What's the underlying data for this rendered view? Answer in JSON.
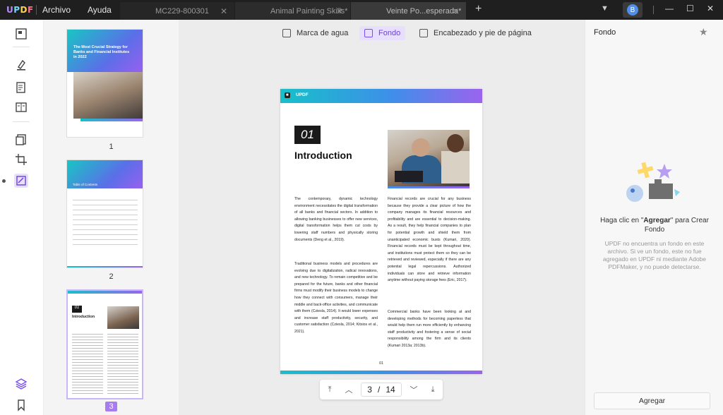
{
  "app": {
    "logo": "UPDF",
    "menu": [
      "Archivo",
      "Ayuda"
    ],
    "tabs": [
      {
        "label": "MC229-800301",
        "active": false
      },
      {
        "label": "Animal Painting Skills*",
        "active": false
      },
      {
        "label": "Veinte Po...esperada*",
        "active": true
      }
    ],
    "user_initial": "B"
  },
  "toolbar": {
    "items": [
      {
        "label": "Marca de agua",
        "icon": "watermark-icon"
      },
      {
        "label": "Fondo",
        "icon": "background-icon",
        "active": true
      },
      {
        "label": "Encabezado y pie de página",
        "icon": "header-footer-icon"
      }
    ]
  },
  "thumbnails": {
    "pages": [
      {
        "number": "1",
        "title": "The Most Crucial Strategy for Banks and Financial Institutes in 2022"
      },
      {
        "number": "2",
        "title": "Table of Contents"
      },
      {
        "number": "3",
        "title": "Introduction",
        "selected": true
      }
    ]
  },
  "page": {
    "brand": "UPDF",
    "chapter_number": "01",
    "heading": "Introduction",
    "left_column": [
      "The contemporary, dynamic technology environment necessitates the digital transformation of all banks and financial sectors. In addition to allowing banking businesses to offer new services, digital transformation helps them cut costs by lowering staff numbers and physically storing documents (Deng et al., 2019).",
      "Traditional business models and procedures are evolving due to digitalization, radical innovations, and new technology. To remain competitive and be prepared for the future, banks and other financial firms must modify their business models to change how they connect with consumers, manage their middle and back-office activities, and communicate with them (Cziesla, 2014). It would lower expenses and increase staff productivity, security, and customer satisfaction (Cziesla, 2014; Kitsios et al., 2021)."
    ],
    "right_column": [
      "Financial records are crucial for any business because they provide a clear picture of how the company manages its financial resources and profitability and are essential to decision-making. As a result, they help financial companies to plan for potential growth and shield them from unanticipated economic busts (Kumari, 2020). Financial records must be kept throughout time, and institutions must protect them so they can be retrieved and reviewed, especially if there are any potential legal repercussions. Authorized individuals can store and retrieve information anytime without paying storage fees (Eric, 2017).",
      "Commercial banks have been looking at and developing methods for becoming paperless that would help them run more efficiently by enhancing staff productivity and fostering a sense of social responsibility among the firm and its clients (Kumari 2013a; 2013b)."
    ],
    "footer_number": "01"
  },
  "navigation": {
    "current_page": "3",
    "separator": "/",
    "total_pages": "14"
  },
  "right_panel": {
    "title": "Fondo",
    "hint_prefix": "Haga clic en \"",
    "hint_bold": "Agregar",
    "hint_suffix": "\" para Crear Fondo",
    "description": "UPDF no encuentra un fondo en este archivo. Si ve un fondo, este no fue agregado en UPDF ni mediante Adobe PDFMaker, y no puede detectarse.",
    "add_button": "Agregar"
  },
  "colors": {
    "accent": "#7a4ff0",
    "titlebar": "#1f1f1f",
    "gradient_start": "#17c0c9",
    "gradient_end": "#9b63ee"
  }
}
